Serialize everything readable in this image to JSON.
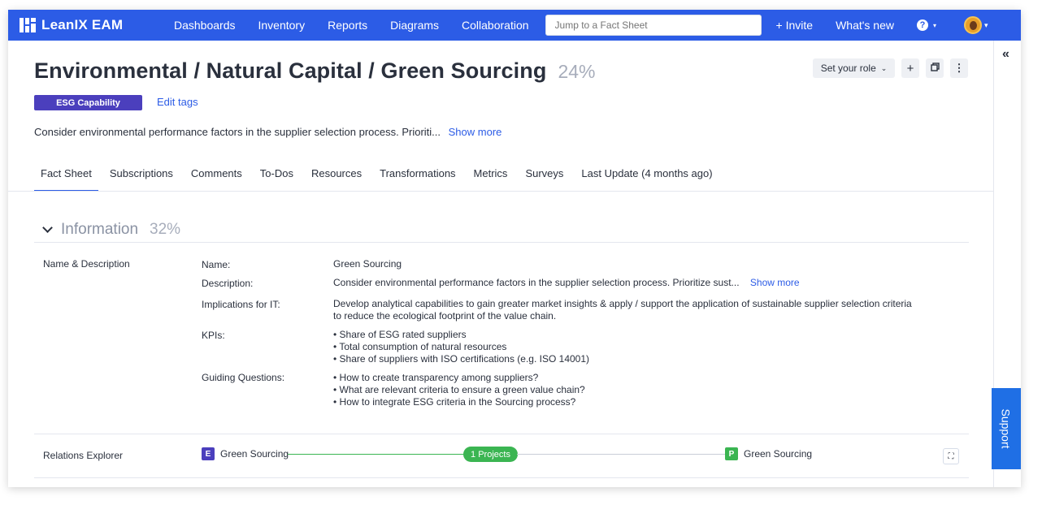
{
  "nav": {
    "brand": "LeanIX EAM",
    "links": [
      "Dashboards",
      "Inventory",
      "Reports",
      "Diagrams",
      "Collaboration"
    ],
    "search_placeholder": "Jump to a Fact Sheet",
    "invite": "+ Invite",
    "whats_new": "What's new",
    "help_glyph": "?"
  },
  "header": {
    "title": "Environmental / Natural Capital / Green Sourcing",
    "completion": "24%",
    "tag": "ESG Capability",
    "edit_tags": "Edit tags",
    "description": "Consider environmental performance factors in the supplier selection process. Prioriti...",
    "show_more": "Show more",
    "role_button": "Set your role",
    "plus": "+",
    "copy_icon": "copy-icon",
    "more_icon": "more-vertical-icon"
  },
  "tabs": [
    {
      "label": "Fact Sheet",
      "active": true
    },
    {
      "label": "Subscriptions"
    },
    {
      "label": "Comments"
    },
    {
      "label": "To-Dos"
    },
    {
      "label": "Resources"
    },
    {
      "label": "Transformations"
    },
    {
      "label": "Metrics"
    },
    {
      "label": "Surveys"
    },
    {
      "label": "Last Update (4 months ago)"
    }
  ],
  "information": {
    "title": "Information",
    "completion": "32%",
    "group": "Name & Description",
    "fields": {
      "name_label": "Name:",
      "name_value": "Green Sourcing",
      "description_label": "Description:",
      "description_value": "Consider environmental performance factors in the supplier selection process. Prioritize sust...",
      "description_more": "Show more",
      "implications_label": "Implications for IT:",
      "implications_line1": "Develop analytical capabilities to gain greater market insights & apply / support the application of sustainable supplier selection criteria",
      "implications_line2": "to reduce the ecological footprint of the value chain.",
      "kpis_label": "KPIs:",
      "kpis": [
        "• Share of ESG rated suppliers",
        "• Total consumption of natural resources",
        "• Share of suppliers with ISO certifications (e.g. ISO 14001)"
      ],
      "questions_label": "Guiding Questions:",
      "questions": [
        "• How to create transparency among suppliers?",
        "• What are relevant criteria to ensure a green value chain?",
        "• How to integrate ESG criteria in the Sourcing process?"
      ]
    }
  },
  "relations": {
    "label": "Relations Explorer",
    "left_badge": "E",
    "left_name": "Green Sourcing",
    "middle": "1 Projects",
    "right_badge": "P",
    "right_name": "Green Sourcing",
    "colors": {
      "left_badge": "#4b3fbd",
      "right_badge": "#3bb552",
      "connector": "#3bb552"
    }
  },
  "sidebar": {
    "collapse_glyph": "«",
    "support": "Support"
  }
}
